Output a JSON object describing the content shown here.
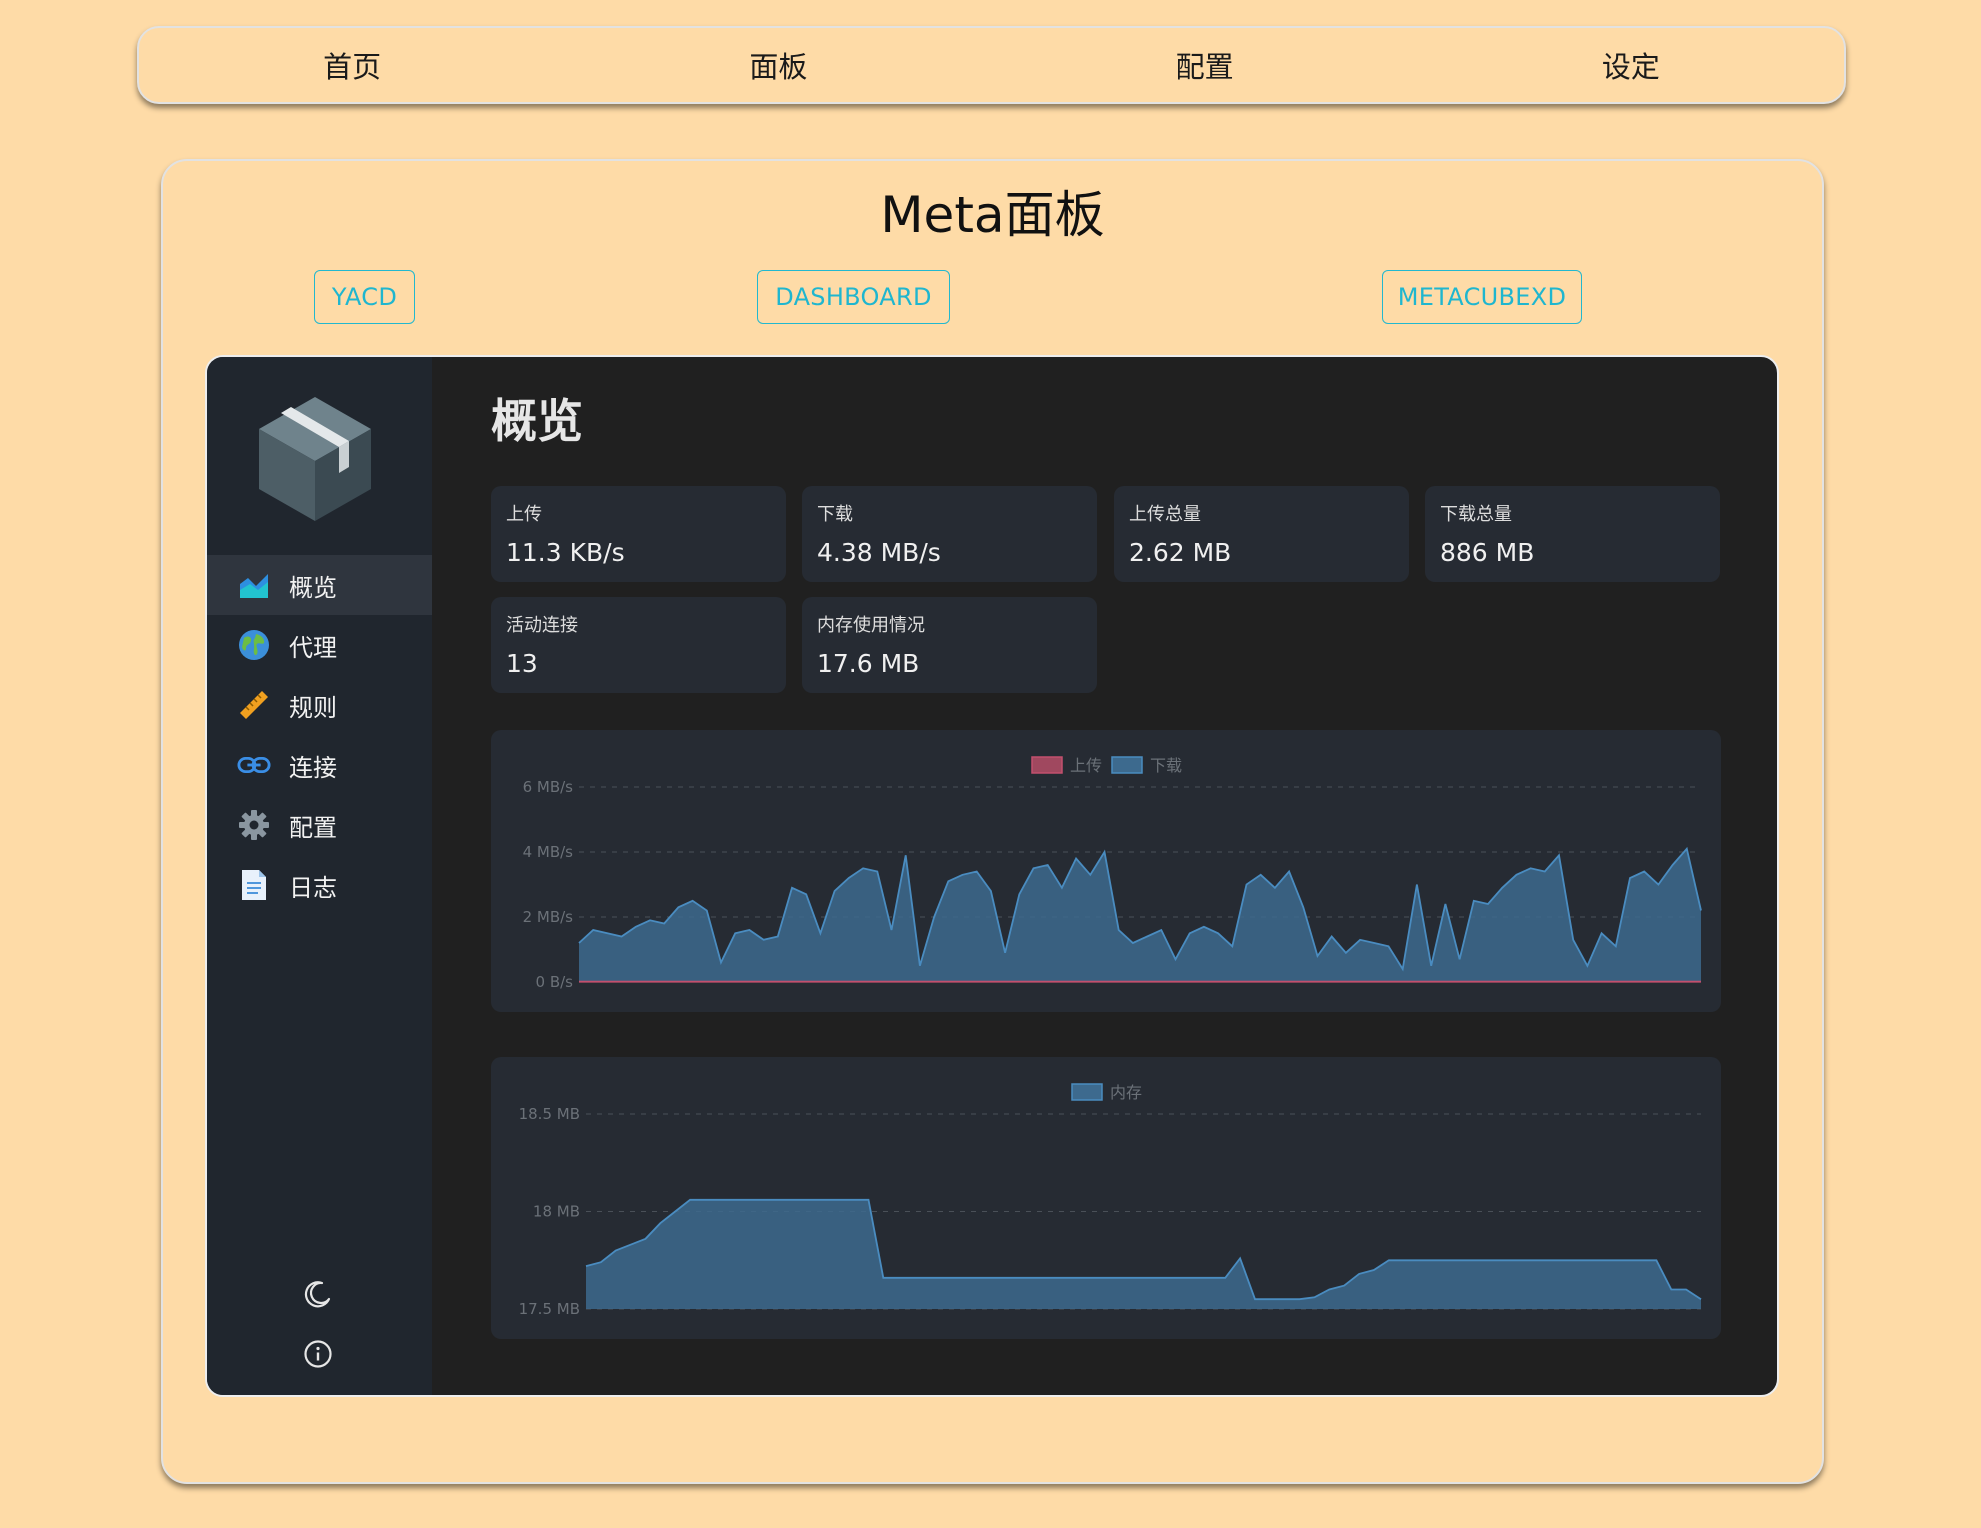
{
  "topnav": {
    "items": [
      "首页",
      "面板",
      "配置",
      "设定"
    ]
  },
  "panel": {
    "title": "Meta面板",
    "tabs": [
      "YACD",
      "DASHBOARD",
      "METACUBEXD"
    ]
  },
  "dashboard": {
    "title": "概览",
    "sidebar": [
      {
        "label": "概览",
        "icon": "area-chart-icon",
        "active": true
      },
      {
        "label": "代理",
        "icon": "globe-icon",
        "active": false
      },
      {
        "label": "规则",
        "icon": "ruler-icon",
        "active": false
      },
      {
        "label": "连接",
        "icon": "link-icon",
        "active": false
      },
      {
        "label": "配置",
        "icon": "gear-icon",
        "active": false
      },
      {
        "label": "日志",
        "icon": "document-icon",
        "active": false
      }
    ],
    "bottom_icons": [
      "moon-icon",
      "info-icon"
    ],
    "stats": [
      {
        "label": "上传",
        "value": "11.3 KB/s"
      },
      {
        "label": "下载",
        "value": "4.38 MB/s"
      },
      {
        "label": "上传总量",
        "value": "2.62 MB"
      },
      {
        "label": "下载总量",
        "value": "886 MB"
      },
      {
        "label": "活动连接",
        "value": "13"
      },
      {
        "label": "内存使用情况",
        "value": "17.6 MB"
      }
    ]
  },
  "colors": {
    "upload": "#a0485f",
    "download": "#3d6a8e",
    "download_line": "#4a8cc0"
  },
  "chart_data": [
    {
      "type": "area",
      "legend": [
        "上传",
        "下载"
      ],
      "legend_position": "top-center",
      "yticks": [
        "6 MB/s",
        "4 MB/s",
        "2 MB/s",
        "0 B/s"
      ],
      "ylim": [
        0,
        6
      ],
      "grid": true,
      "series": [
        {
          "name": "上传",
          "values": [
            0.01,
            0.01,
            0.01,
            0.01,
            0.01,
            0.01,
            0.01,
            0.01,
            0.01,
            0.01,
            0.01,
            0.01,
            0.01,
            0.01,
            0.01,
            0.01,
            0.01,
            0.01,
            0.01,
            0.01,
            0.01,
            0.01,
            0.01,
            0.01,
            0.01,
            0.01,
            0.01,
            0.01,
            0.01,
            0.01,
            0.01,
            0.01,
            0.01,
            0.01,
            0.01,
            0.01,
            0.01,
            0.01,
            0.01,
            0.01,
            0.01,
            0.01,
            0.01,
            0.01,
            0.01,
            0.01,
            0.01,
            0.01,
            0.01,
            0.01,
            0.01,
            0.01,
            0.01,
            0.01,
            0.01,
            0.01,
            0.01,
            0.01,
            0.01,
            0.01,
            0.01,
            0.01,
            0.01,
            0.01,
            0.01,
            0.01,
            0.01,
            0.01,
            0.01,
            0.01,
            0.01,
            0.01,
            0.01,
            0.01,
            0.01,
            0.01,
            0.01,
            0.01,
            0.01,
            0.01
          ]
        },
        {
          "name": "下载",
          "values": [
            1.2,
            1.6,
            1.5,
            1.4,
            1.7,
            1.9,
            1.8,
            2.3,
            2.5,
            2.2,
            0.6,
            1.5,
            1.6,
            1.3,
            1.4,
            2.9,
            2.7,
            1.5,
            2.8,
            3.2,
            3.5,
            3.4,
            1.6,
            3.9,
            0.5,
            2.0,
            3.1,
            3.3,
            3.4,
            2.8,
            0.9,
            2.7,
            3.5,
            3.6,
            2.9,
            3.8,
            3.3,
            4.0,
            1.6,
            1.2,
            1.4,
            1.6,
            0.7,
            1.5,
            1.7,
            1.5,
            1.1,
            3.0,
            3.3,
            2.9,
            3.4,
            2.3,
            0.8,
            1.4,
            0.9,
            1.3,
            1.2,
            1.1,
            0.4,
            3.0,
            0.5,
            2.4,
            0.7,
            2.5,
            2.4,
            2.9,
            3.3,
            3.5,
            3.4,
            3.9,
            1.3,
            0.5,
            1.5,
            1.1,
            3.2,
            3.4,
            3.0,
            3.6,
            4.1,
            2.2
          ]
        }
      ]
    },
    {
      "type": "area",
      "legend": [
        "内存"
      ],
      "legend_position": "top-center",
      "yticks": [
        "18.5 MB",
        "18 MB",
        "17.5 MB"
      ],
      "ylim": [
        17.5,
        18.5
      ],
      "grid": true,
      "series": [
        {
          "name": "内存",
          "values": [
            17.72,
            17.74,
            17.8,
            17.83,
            17.86,
            17.94,
            18.0,
            18.06,
            18.06,
            18.06,
            18.06,
            18.06,
            18.06,
            18.06,
            18.06,
            18.06,
            18.06,
            18.06,
            18.06,
            18.06,
            17.66,
            17.66,
            17.66,
            17.66,
            17.66,
            17.66,
            17.66,
            17.66,
            17.66,
            17.66,
            17.66,
            17.66,
            17.66,
            17.66,
            17.66,
            17.66,
            17.66,
            17.66,
            17.66,
            17.66,
            17.66,
            17.66,
            17.66,
            17.66,
            17.76,
            17.55,
            17.55,
            17.55,
            17.55,
            17.56,
            17.6,
            17.62,
            17.68,
            17.7,
            17.75,
            17.75,
            17.75,
            17.75,
            17.75,
            17.75,
            17.75,
            17.75,
            17.75,
            17.75,
            17.75,
            17.75,
            17.75,
            17.75,
            17.75,
            17.75,
            17.75,
            17.75,
            17.75,
            17.6,
            17.6,
            17.55
          ]
        }
      ]
    }
  ]
}
